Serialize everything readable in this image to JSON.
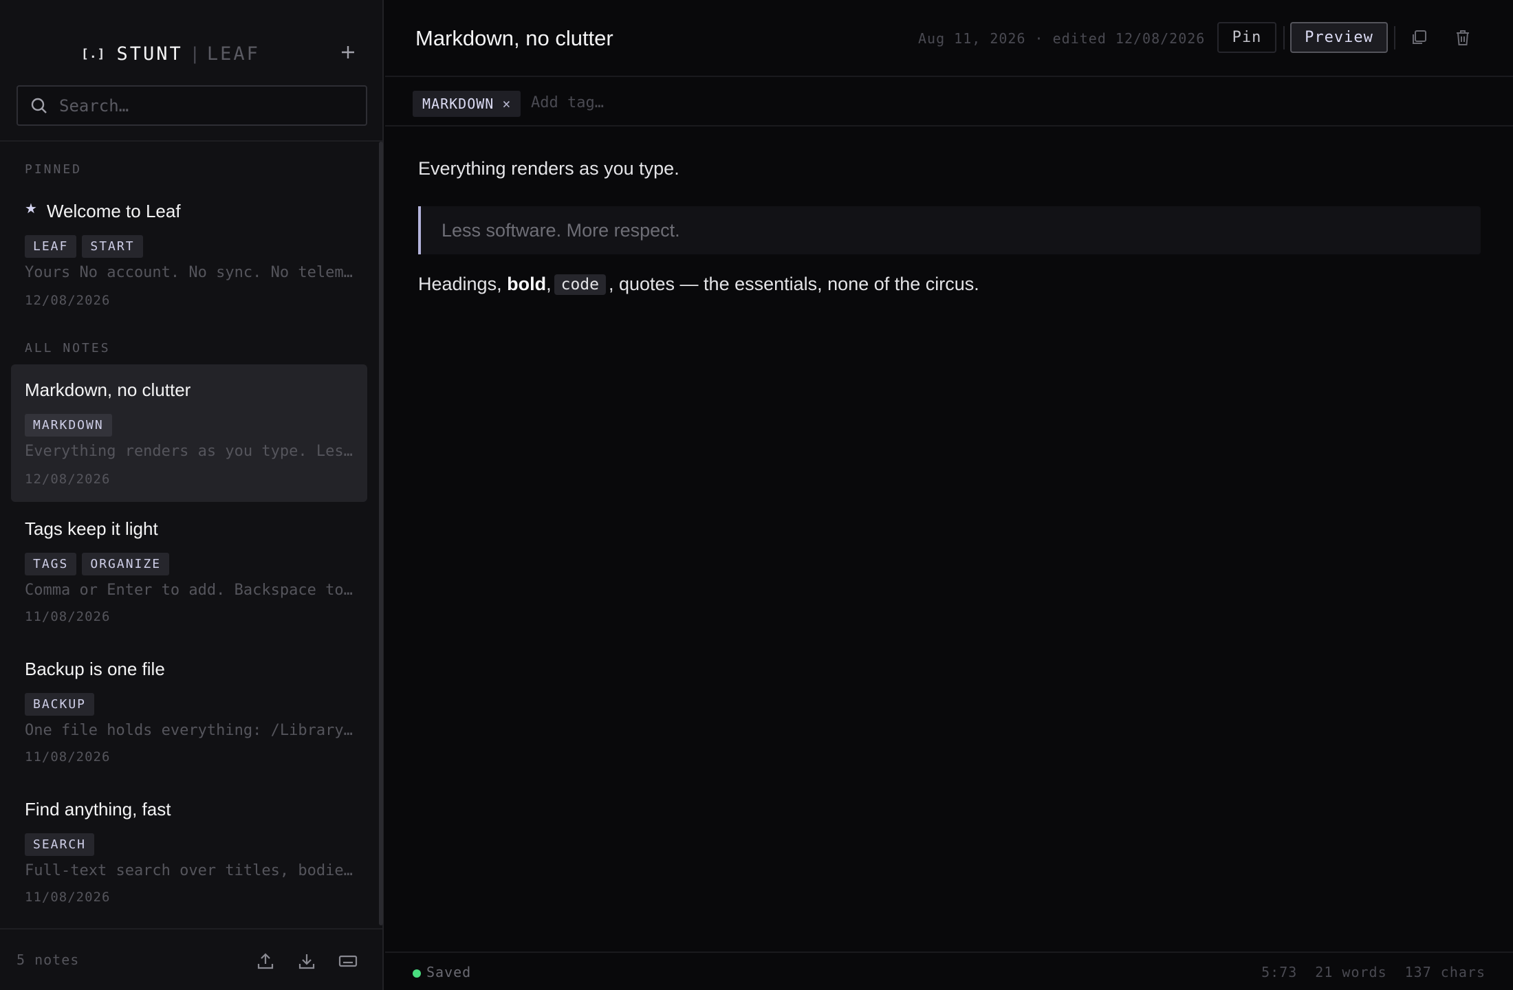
{
  "app": {
    "brand_mark": "[.]",
    "brand_name": "STUNT",
    "brand_separator": "|",
    "brand_sub": "LEAF"
  },
  "search": {
    "placeholder": "Search…"
  },
  "sections": {
    "pinned": "PINNED",
    "all": "ALL NOTES"
  },
  "pinned_notes": [
    {
      "title": "Welcome to Leaf",
      "tags": [
        "LEAF",
        "START"
      ],
      "preview": "Yours No account. No sync. No telemetry.",
      "date": "12/08/2026",
      "starred": true
    }
  ],
  "notes": [
    {
      "title": "Markdown, no clutter",
      "tags": [
        "MARKDOWN"
      ],
      "preview": "Everything renders as you type. Less software. More respect.",
      "date": "12/08/2026",
      "active": true
    },
    {
      "title": "Tags keep it light",
      "tags": [
        "TAGS",
        "ORGANIZE"
      ],
      "preview": "Comma or Enter to add. Backspace to remove.",
      "date": "11/08/2026"
    },
    {
      "title": "Backup is one file",
      "tags": [
        "BACKUP"
      ],
      "preview": "One file holds everything: /Library/Leaf",
      "date": "11/08/2026"
    },
    {
      "title": "Find anything, fast",
      "tags": [
        "SEARCH"
      ],
      "preview": "Full-text search over titles, bodies and tags.",
      "date": "11/08/2026"
    }
  ],
  "footer": {
    "count": "5 notes",
    "icons": [
      "export-icon",
      "import-icon",
      "keyboard-icon"
    ]
  },
  "editor": {
    "title": "Markdown, no clutter",
    "meta": "Aug 11, 2026 · edited 12/08/2026",
    "pin_label": "Pin",
    "preview_label": "Preview",
    "tag": "MARKDOWN",
    "tag_remove": "×",
    "tag_placeholder": "Add tag…",
    "line1": "Everything renders as you type.",
    "quote": "Less software. More respect.",
    "line3_a": "Headings, ",
    "line3_bold": "bold",
    "line3_b": ",",
    "line3_code": "code",
    "line3_c": ", quotes — the essentials, none of the circus."
  },
  "status": {
    "saved": "Saved",
    "position": "5:73",
    "words": "21 words",
    "chars": "137 chars",
    "saved_color": "#4ade80"
  },
  "colors": {
    "accent": "#b4b4dc",
    "background": "#09090b",
    "sidebar": "#111114"
  }
}
